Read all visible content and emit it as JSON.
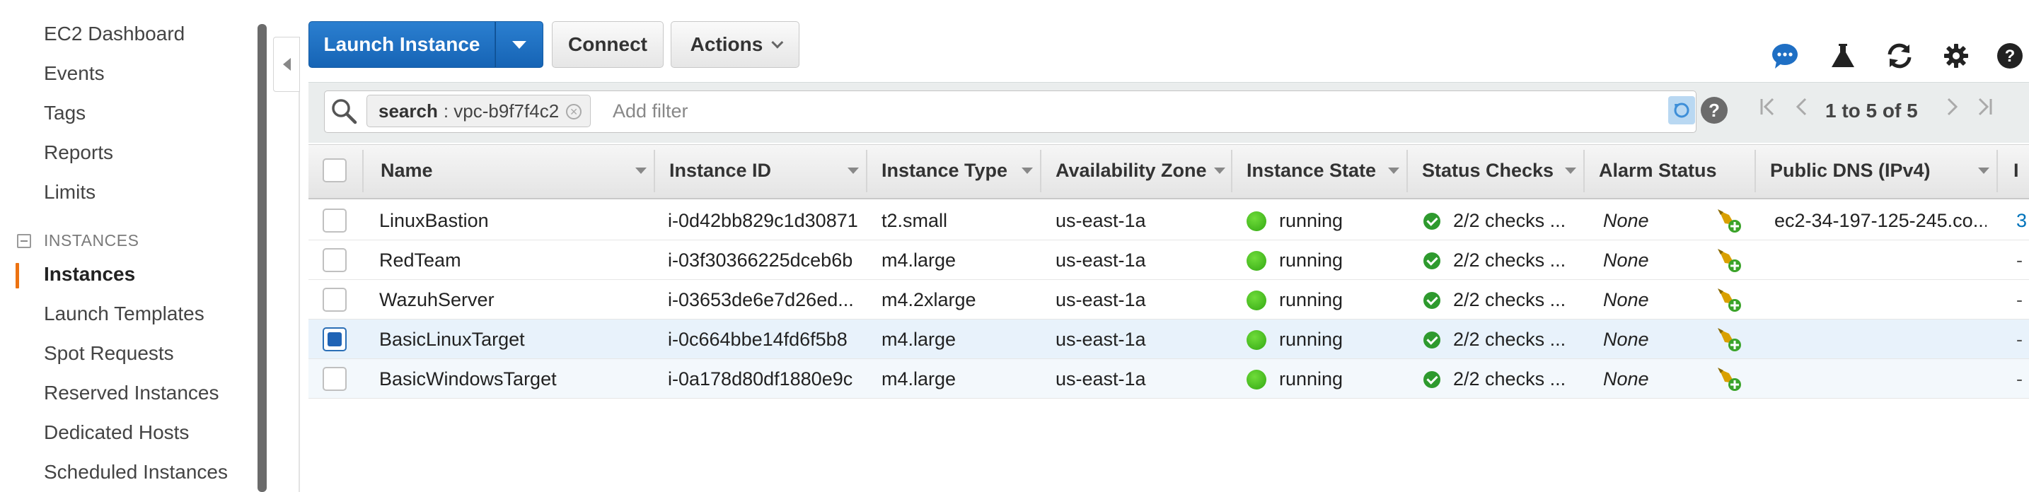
{
  "sidebar": {
    "items": [
      {
        "label": "EC2 Dashboard"
      },
      {
        "label": "Events"
      },
      {
        "label": "Tags"
      },
      {
        "label": "Reports"
      },
      {
        "label": "Limits"
      }
    ],
    "section_title": "INSTANCES",
    "section_items": [
      {
        "label": "Instances",
        "active": true
      },
      {
        "label": "Launch Templates"
      },
      {
        "label": "Spot Requests"
      },
      {
        "label": "Reserved Instances"
      },
      {
        "label": "Dedicated Hosts"
      },
      {
        "label": "Scheduled Instances"
      }
    ]
  },
  "toolbar": {
    "launch_label": "Launch Instance",
    "connect_label": "Connect",
    "actions_label": "Actions",
    "icons": [
      "chat-icon",
      "flask-icon",
      "refresh-icon",
      "gear-icon",
      "help-icon"
    ]
  },
  "filter": {
    "token_key": "search",
    "token_value": ": vpc-b9f7f4c2",
    "placeholder": "Add filter"
  },
  "pagination": {
    "text": "1 to 5 of 5"
  },
  "table": {
    "columns": [
      "Name",
      "Instance ID",
      "Instance Type",
      "Availability Zone",
      "Instance State",
      "Status Checks",
      "Alarm Status",
      "Public DNS (IPv4)",
      "I"
    ],
    "rows": [
      {
        "name": "LinuxBastion",
        "id": "i-0d42bb829c1d30871",
        "type": "t2.small",
        "az": "us-east-1a",
        "state": "running",
        "checks": "2/2 checks ...",
        "alarm": "None",
        "dns": "ec2-34-197-125-245.co...",
        "extra": "3",
        "selected": false
      },
      {
        "name": "RedTeam",
        "id": "i-03f30366225dceb6b",
        "type": "m4.large",
        "az": "us-east-1a",
        "state": "running",
        "checks": "2/2 checks ...",
        "alarm": "None",
        "dns": "",
        "extra": "-",
        "selected": false
      },
      {
        "name": "WazuhServer",
        "id": "i-03653de6e7d26ed...",
        "type": "m4.2xlarge",
        "az": "us-east-1a",
        "state": "running",
        "checks": "2/2 checks ...",
        "alarm": "None",
        "dns": "",
        "extra": "-",
        "selected": false
      },
      {
        "name": "BasicLinuxTarget",
        "id": "i-0c664bbe14fd6f5b8",
        "type": "m4.large",
        "az": "us-east-1a",
        "state": "running",
        "checks": "2/2 checks ...",
        "alarm": "None",
        "dns": "",
        "extra": "-",
        "selected": true
      },
      {
        "name": "BasicWindowsTarget",
        "id": "i-0a178d80df1880e9c",
        "type": "m4.large",
        "az": "us-east-1a",
        "state": "running",
        "checks": "2/2 checks ...",
        "alarm": "None",
        "dns": "",
        "extra": "-",
        "selected": false
      }
    ]
  },
  "colors": {
    "primary": "#1f63b5",
    "accent": "#ec7211",
    "running": "#3cb01b",
    "link": "#0073bb"
  }
}
